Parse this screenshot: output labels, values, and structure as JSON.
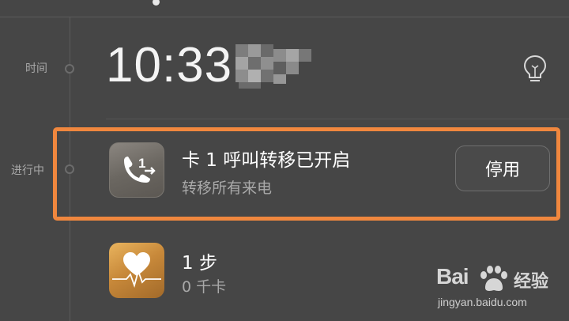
{
  "timeline": {
    "time_label": "时间",
    "in_progress_label": "进行中"
  },
  "clock": {
    "time": "10:33"
  },
  "cards": {
    "call_forwarding": {
      "icon": "phone-forward-icon",
      "title": "卡 1 呼叫转移已开启",
      "subtitle": "转移所有来电",
      "button_label": "停用"
    },
    "steps": {
      "icon": "heart-pulse-icon",
      "title": "1 步",
      "subtitle": "0 千卡"
    }
  },
  "watermark": {
    "brand": "Bai",
    "brand_suffix": "经验",
    "url": "jingyan.baidu.com"
  },
  "colors": {
    "background": "#464646",
    "highlight": "#f0873e",
    "health_icon": "#c8893a"
  }
}
